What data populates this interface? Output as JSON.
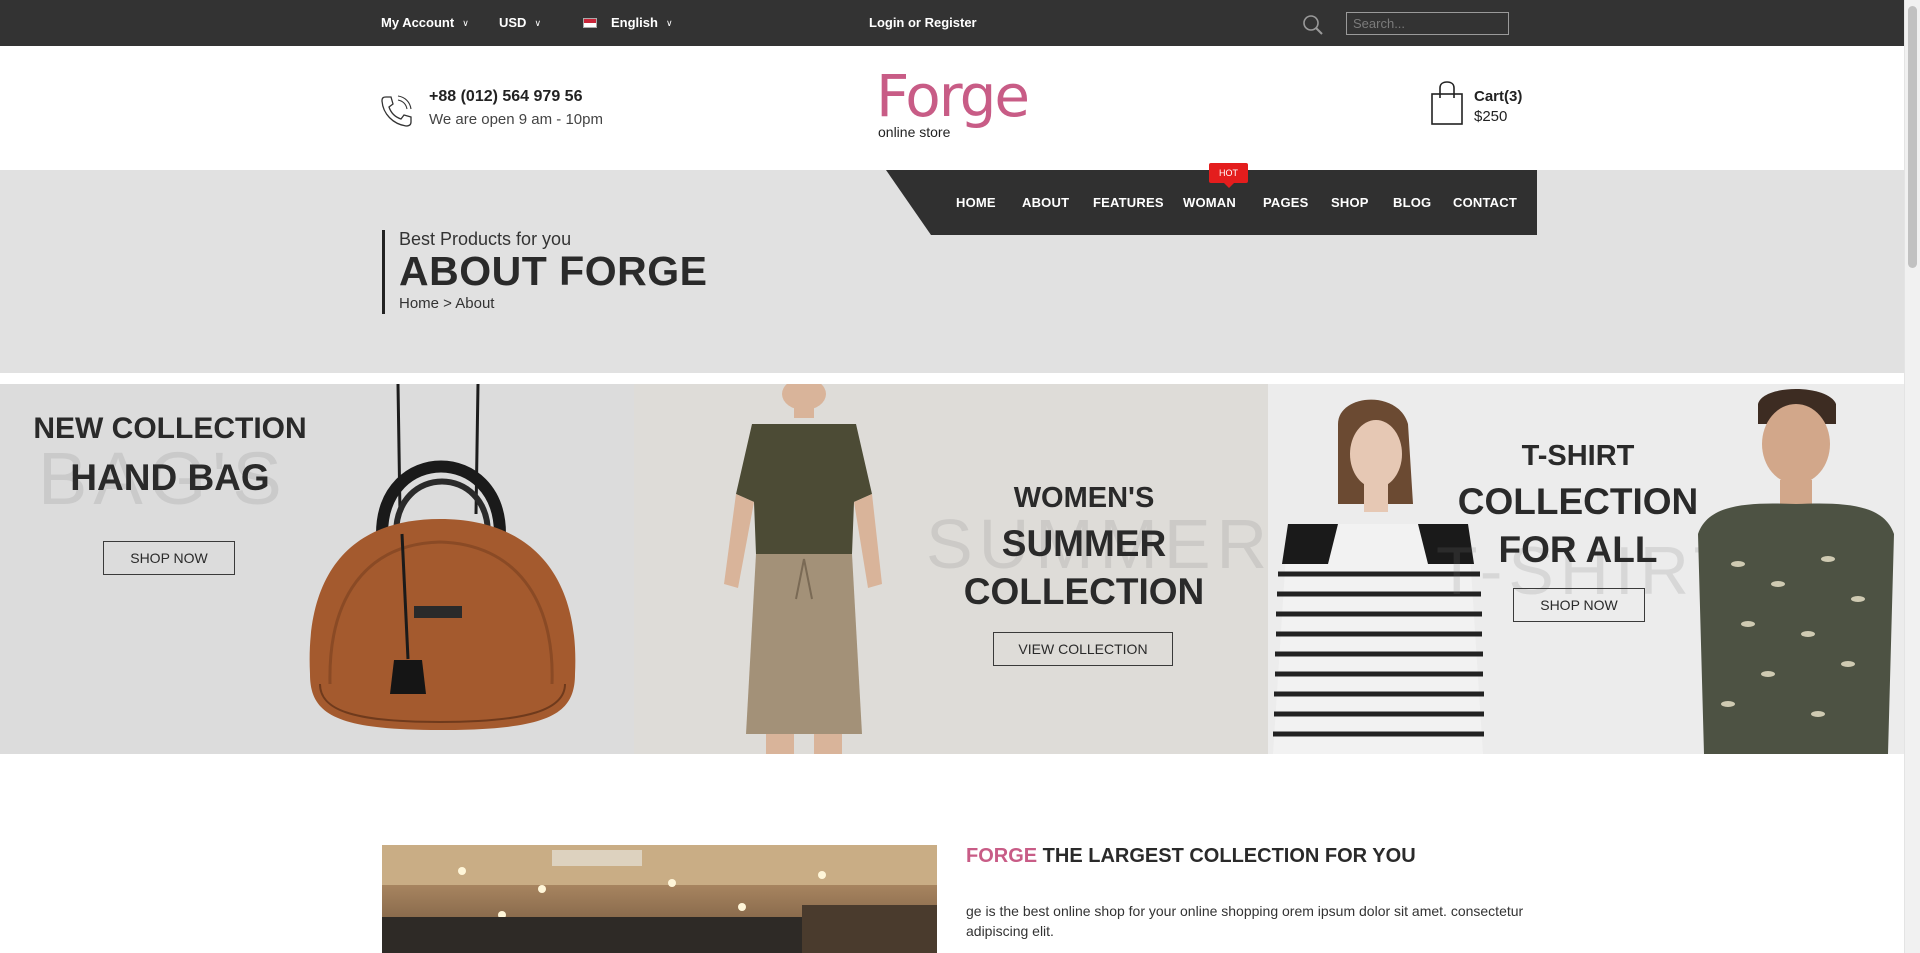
{
  "topbar": {
    "account_label": "My Account",
    "currency_label": "USD",
    "language_label": "English",
    "login_label": "Login or Register",
    "search_placeholder": "Search..."
  },
  "header": {
    "phone": "+88 (012) 564 979 56",
    "open_hours": "We are open 9 am - 10pm",
    "logo_main": "Forge",
    "logo_sub": "online store",
    "cart_label": "Cart(3)",
    "cart_total": "$250"
  },
  "nav": {
    "items": [
      {
        "label": "HOME"
      },
      {
        "label": "ABOUT"
      },
      {
        "label": "FEATURES"
      },
      {
        "label": "WOMAN"
      },
      {
        "label": "PAGES"
      },
      {
        "label": "SHOP"
      },
      {
        "label": "BLOG"
      },
      {
        "label": "CONTACT"
      }
    ],
    "hot_badge": "HOT"
  },
  "banner": {
    "subtitle": "Best Products for you",
    "title": "ABOUT FORGE",
    "breadcrumb": "Home > About"
  },
  "promos": [
    {
      "line1": "NEW COLLECTION",
      "line2": "HAND BAG",
      "ghost": "BAG'S",
      "button": "SHOP NOW"
    },
    {
      "line1": "WOMEN'S",
      "line2": "SUMMER",
      "line3": "COLLECTION",
      "ghost": "SUMMER",
      "button": "VIEW COLLECTION"
    },
    {
      "line1": "T-SHIRT",
      "line2": "COLLECTION",
      "line3": "FOR ALL",
      "ghost": "T-SHIRT",
      "button": "SHOP NOW"
    }
  ],
  "about": {
    "brand": "FORGE",
    "title_rest": " THE LARGEST COLLECTION FOR YOU",
    "text": "ge is the best online shop for your online shopping orem ipsum dolor sit amet. consectetur adipiscing elit."
  },
  "colors": {
    "topbar": "#333333",
    "brand_pink": "#c85c86",
    "nav_bg": "#303030",
    "banner_bg": "#e1e1e1",
    "hot_red": "#e41d1d"
  },
  "icons": [
    "chevron-down-icon",
    "flag-icon",
    "search-icon",
    "phone-icon",
    "shopping-bag-icon"
  ]
}
